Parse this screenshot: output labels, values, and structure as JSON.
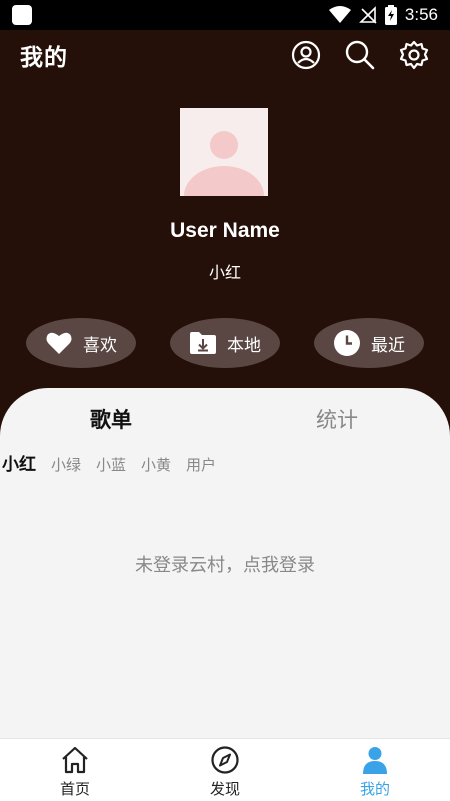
{
  "status_bar": {
    "time": "3:56"
  },
  "header": {
    "title": "我的"
  },
  "profile": {
    "name": "User Name",
    "subtitle": "小红"
  },
  "quick_actions": [
    {
      "label": "喜欢",
      "icon": "heart-icon"
    },
    {
      "label": "本地",
      "icon": "folder-download-icon"
    },
    {
      "label": "最近",
      "icon": "clock-icon"
    }
  ],
  "tabs": [
    {
      "label": "歌单",
      "active": true
    },
    {
      "label": "统计",
      "active": false
    }
  ],
  "filters": [
    "小红",
    "小绿",
    "小蓝",
    "小黄",
    "用户"
  ],
  "login_tip": "未登录云村，点我登录",
  "bottom_nav": [
    {
      "label": "首页",
      "icon": "home-icon"
    },
    {
      "label": "发现",
      "icon": "compass-icon"
    },
    {
      "label": "我的",
      "icon": "user-icon",
      "active": true
    }
  ],
  "colors": {
    "header_bg": "#241008",
    "accent": "#3aa3e8",
    "panel_bg": "#f4f4f4",
    "pill_bg": "#5a4743"
  }
}
